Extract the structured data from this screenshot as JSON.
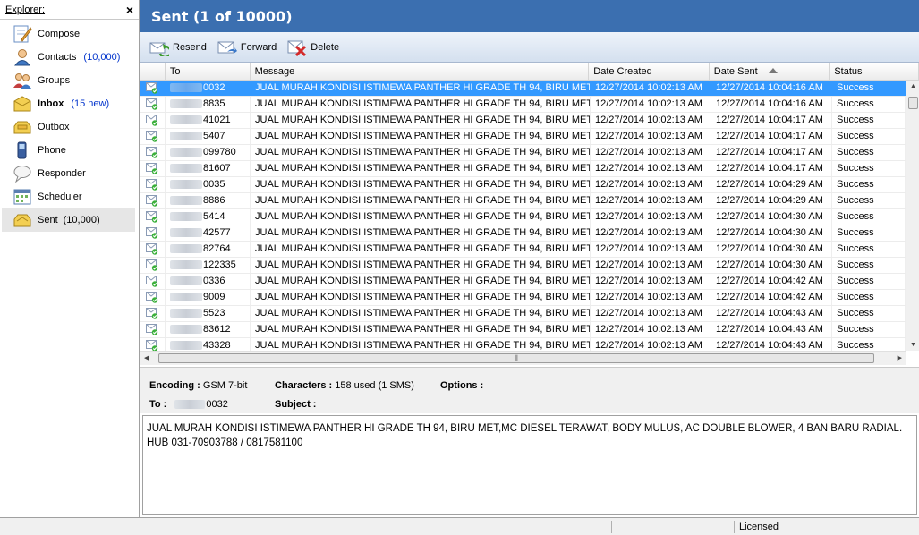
{
  "sidebar": {
    "title": "Explorer:",
    "close": "×",
    "items": [
      {
        "label": "Compose",
        "count": ""
      },
      {
        "label": "Contacts",
        "count": "(10,000)"
      },
      {
        "label": "Groups",
        "count": ""
      },
      {
        "label": "Inbox",
        "count": "(15 new)"
      },
      {
        "label": "Outbox",
        "count": ""
      },
      {
        "label": "Phone",
        "count": ""
      },
      {
        "label": "Responder",
        "count": ""
      },
      {
        "label": "Scheduler",
        "count": ""
      },
      {
        "label": "Sent",
        "count": "(10,000)"
      }
    ]
  },
  "main": {
    "title": "Sent (1 of 10000)",
    "toolbar": {
      "resend": "Resend",
      "forward": "Forward",
      "delete": "Delete"
    },
    "columns": [
      "To",
      "Message",
      "Date Created",
      "Date Sent",
      "Status"
    ],
    "message_text": "JUAL MURAH KONDISI ISTIMEWA PANTHER HI GRADE TH 94, BIRU MET,...",
    "rows": [
      {
        "to": "0032",
        "created": "12/27/2014 10:02:13 AM",
        "sent": "12/27/2014 10:04:16 AM",
        "status": "Success"
      },
      {
        "to": "8835",
        "created": "12/27/2014 10:02:13 AM",
        "sent": "12/27/2014 10:04:16 AM",
        "status": "Success"
      },
      {
        "to": "41021",
        "created": "12/27/2014 10:02:13 AM",
        "sent": "12/27/2014 10:04:17 AM",
        "status": "Success"
      },
      {
        "to": "5407",
        "created": "12/27/2014 10:02:13 AM",
        "sent": "12/27/2014 10:04:17 AM",
        "status": "Success"
      },
      {
        "to": "099780",
        "created": "12/27/2014 10:02:13 AM",
        "sent": "12/27/2014 10:04:17 AM",
        "status": "Success"
      },
      {
        "to": "81607",
        "created": "12/27/2014 10:02:13 AM",
        "sent": "12/27/2014 10:04:17 AM",
        "status": "Success"
      },
      {
        "to": "0035",
        "created": "12/27/2014 10:02:13 AM",
        "sent": "12/27/2014 10:04:29 AM",
        "status": "Success"
      },
      {
        "to": "8886",
        "created": "12/27/2014 10:02:13 AM",
        "sent": "12/27/2014 10:04:29 AM",
        "status": "Success"
      },
      {
        "to": "5414",
        "created": "12/27/2014 10:02:13 AM",
        "sent": "12/27/2014 10:04:30 AM",
        "status": "Success"
      },
      {
        "to": "42577",
        "created": "12/27/2014 10:02:13 AM",
        "sent": "12/27/2014 10:04:30 AM",
        "status": "Success"
      },
      {
        "to": "82764",
        "created": "12/27/2014 10:02:13 AM",
        "sent": "12/27/2014 10:04:30 AM",
        "status": "Success"
      },
      {
        "to": "122335",
        "created": "12/27/2014 10:02:13 AM",
        "sent": "12/27/2014 10:04:30 AM",
        "status": "Success"
      },
      {
        "to": "0336",
        "created": "12/27/2014 10:02:13 AM",
        "sent": "12/27/2014 10:04:42 AM",
        "status": "Success"
      },
      {
        "to": "9009",
        "created": "12/27/2014 10:02:13 AM",
        "sent": "12/27/2014 10:04:42 AM",
        "status": "Success"
      },
      {
        "to": "5523",
        "created": "12/27/2014 10:02:13 AM",
        "sent": "12/27/2014 10:04:43 AM",
        "status": "Success"
      },
      {
        "to": "83612",
        "created": "12/27/2014 10:02:13 AM",
        "sent": "12/27/2014 10:04:43 AM",
        "status": "Success"
      },
      {
        "to": "43328",
        "created": "12/27/2014 10:02:13 AM",
        "sent": "12/27/2014 10:04:43 AM",
        "status": "Success"
      }
    ]
  },
  "details": {
    "encoding_label": "Encoding :",
    "encoding_value": "GSM 7-bit",
    "characters_label": "Characters :",
    "characters_value": "158 used (1 SMS)",
    "options_label": "Options :",
    "to_label": "To :",
    "to_value": "0032",
    "subject_label": "Subject :",
    "body": "JUAL MURAH KONDISI ISTIMEWA PANTHER HI GRADE TH 94, BIRU MET,MC DIESEL TERAWAT, BODY MULUS, AC DOUBLE BLOWER, 4 BAN BARU RADIAL. HUB 031-70903788 / 0817581100"
  },
  "statusbar": {
    "license": "Licensed"
  },
  "colors": {
    "title_bar": "#3b6fb0",
    "selection": "#3399ff",
    "count_link": "#0033cc"
  }
}
